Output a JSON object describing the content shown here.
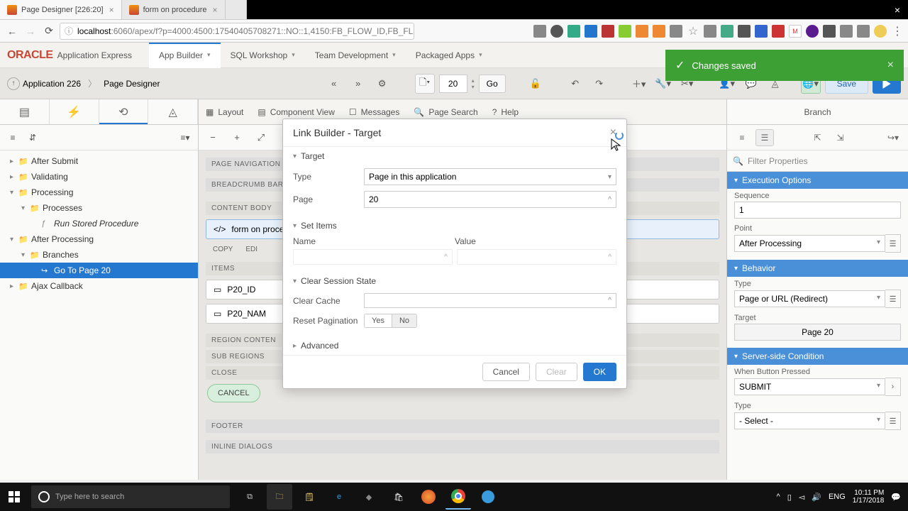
{
  "browser": {
    "tab1": "Page Designer [226:20]",
    "tab2": "form on procedure",
    "url_prefix": "localhost",
    "url": ":6060/apex/f?p=4000:4500:17540405708271::NO::1,4150:FB_FLOW_ID,FB_FLOW"
  },
  "oracle": {
    "logo": "ORACLE",
    "product": "Application Express",
    "menu": {
      "app_builder": "App Builder",
      "sql": "SQL Workshop",
      "team": "Team Development",
      "packaged": "Packaged Apps"
    }
  },
  "toast": {
    "msg": "Changes saved"
  },
  "breadcrumb": {
    "app": "Application 226",
    "page": "Page Designer"
  },
  "toolbar": {
    "page_number": "20",
    "go": "Go",
    "save": "Save"
  },
  "center_tabs": {
    "layout": "Layout",
    "component": "Component View",
    "messages": "Messages",
    "search": "Page Search",
    "help": "Help"
  },
  "center": {
    "page_nav": "PAGE NAVIGATION",
    "bc_bar": "BREADCRUMB BAR",
    "content_body": "CONTENT BODY",
    "form_item": "form on proce",
    "copy": "COPY",
    "edit": "EDI",
    "items": "ITEMS",
    "p20_id": "P20_ID",
    "p20_name": "P20_NAM",
    "region_content": "REGION CONTEN",
    "sub_regions": "SUB REGIONS",
    "close": "CLOSE",
    "cancel": "CANCEL",
    "footer": "FOOTER",
    "inline": "INLINE DIALOGS"
  },
  "tree": {
    "after_submit": "After Submit",
    "validating": "Validating",
    "processing": "Processing",
    "processes": "Processes",
    "run_stored": "Run Stored Procedure",
    "after_processing": "After Processing",
    "branches": "Branches",
    "goto": "Go To Page 20",
    "ajax": "Ajax Callback"
  },
  "right": {
    "tab": "Branch",
    "filter": "Filter Properties",
    "exec_options": "Execution Options",
    "sequence_label": "Sequence",
    "sequence_val": "1",
    "point_label": "Point",
    "point_val": "After Processing",
    "behavior": "Behavior",
    "type_label": "Type",
    "type_val": "Page or URL (Redirect)",
    "target_label": "Target",
    "target_val": "Page 20",
    "ssc": "Server-side Condition",
    "wbp_label": "When Button Pressed",
    "wbp_val": "SUBMIT",
    "c_type_label": "Type",
    "c_type_val": "- Select -"
  },
  "modal": {
    "title": "Link Builder - Target",
    "target_section": "Target",
    "type_label": "Type",
    "type_val": "Page in this application",
    "page_label": "Page",
    "page_val": "20",
    "set_items": "Set Items",
    "name_col": "Name",
    "value_col": "Value",
    "clear_session": "Clear Session State",
    "clear_cache": "Clear Cache",
    "reset_pag": "Reset Pagination",
    "yes": "Yes",
    "no": "No",
    "advanced": "Advanced",
    "cancel": "Cancel",
    "clear": "Clear",
    "ok": "OK"
  },
  "taskbar": {
    "search_placeholder": "Type here to search",
    "lang": "ENG",
    "time": "10:11 PM",
    "date": "1/17/2018"
  }
}
